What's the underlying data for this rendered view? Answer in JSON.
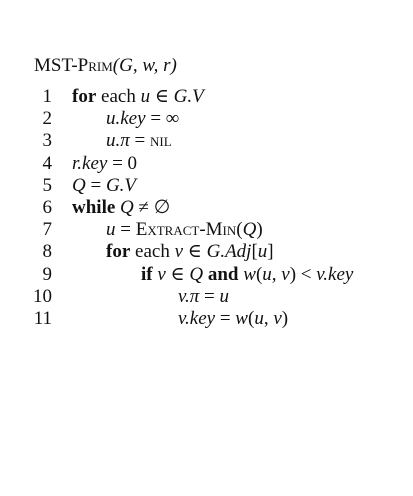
{
  "title": {
    "name": "MST-Prim",
    "args": "(G, w, r)"
  },
  "lines": [
    {
      "num": "1",
      "indent": 0,
      "parts": [
        {
          "t": "for",
          "s": "bold"
        },
        {
          "t": " each "
        },
        {
          "t": "u",
          "s": "it"
        },
        {
          "t": " ∈ "
        },
        {
          "t": "G.V",
          "s": "it"
        }
      ]
    },
    {
      "num": "2",
      "indent": 1,
      "parts": [
        {
          "t": "u.key",
          "s": "it"
        },
        {
          "t": " = ∞"
        }
      ]
    },
    {
      "num": "3",
      "indent": 1,
      "parts": [
        {
          "t": "u.π",
          "s": "it"
        },
        {
          "t": " = "
        },
        {
          "t": "nil",
          "s": "sc"
        }
      ]
    },
    {
      "num": "4",
      "indent": 0,
      "parts": [
        {
          "t": "r.key",
          "s": "it"
        },
        {
          "t": " = 0"
        }
      ]
    },
    {
      "num": "5",
      "indent": 0,
      "parts": [
        {
          "t": "Q",
          "s": "it"
        },
        {
          "t": " = "
        },
        {
          "t": "G.V",
          "s": "it"
        }
      ]
    },
    {
      "num": "6",
      "indent": 0,
      "parts": [
        {
          "t": "while",
          "s": "bold"
        },
        {
          "t": " "
        },
        {
          "t": "Q",
          "s": "it"
        },
        {
          "t": " ≠ ∅"
        }
      ]
    },
    {
      "num": "7",
      "indent": 1,
      "parts": [
        {
          "t": "u",
          "s": "it"
        },
        {
          "t": " = "
        },
        {
          "t": "Extract-Min",
          "s": "sc"
        },
        {
          "t": "("
        },
        {
          "t": "Q",
          "s": "it"
        },
        {
          "t": ")"
        }
      ]
    },
    {
      "num": "8",
      "indent": 1,
      "parts": [
        {
          "t": "for",
          "s": "bold"
        },
        {
          "t": " each "
        },
        {
          "t": "v",
          "s": "it"
        },
        {
          "t": " ∈ "
        },
        {
          "t": "G.Adj",
          "s": "it"
        },
        {
          "t": "["
        },
        {
          "t": "u",
          "s": "it"
        },
        {
          "t": "]"
        }
      ]
    },
    {
      "num": "9",
      "indent": 2,
      "parts": [
        {
          "t": "if",
          "s": "bold"
        },
        {
          "t": " "
        },
        {
          "t": "v",
          "s": "it"
        },
        {
          "t": " ∈ "
        },
        {
          "t": "Q",
          "s": "it"
        },
        {
          "t": " and",
          "s": "bold"
        },
        {
          "t": " "
        },
        {
          "t": "w",
          "s": "it"
        },
        {
          "t": "("
        },
        {
          "t": "u",
          "s": "it"
        },
        {
          "t": ", "
        },
        {
          "t": "v",
          "s": "it"
        },
        {
          "t": ") < "
        },
        {
          "t": "v.key",
          "s": "it"
        }
      ]
    },
    {
      "num": "10",
      "indent": 3,
      "parts": [
        {
          "t": "v.π",
          "s": "it"
        },
        {
          "t": " = "
        },
        {
          "t": "u",
          "s": "it"
        }
      ]
    },
    {
      "num": "11",
      "indent": 3,
      "parts": [
        {
          "t": "v.key",
          "s": "it"
        },
        {
          "t": " = "
        },
        {
          "t": "w",
          "s": "it"
        },
        {
          "t": "("
        },
        {
          "t": "u",
          "s": "it"
        },
        {
          "t": ", "
        },
        {
          "t": "v",
          "s": "it"
        },
        {
          "t": ")"
        }
      ]
    }
  ]
}
